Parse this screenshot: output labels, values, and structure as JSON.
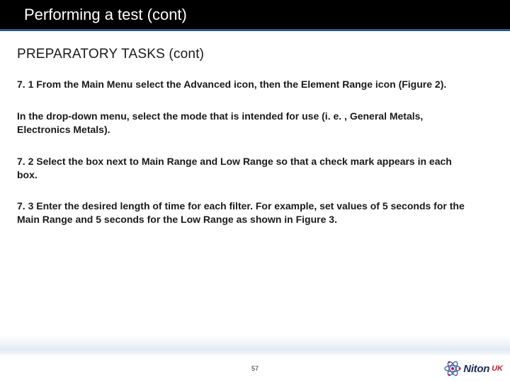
{
  "header": {
    "title": "Performing a test (cont)"
  },
  "content": {
    "section_heading": "PREPARATORY TASKS (cont)",
    "paragraphs": [
      "7. 1 From the Main Menu select the Advanced icon, then the Element Range icon (Figure 2).",
      "In the drop-down menu, select the mode that is intended for use (i. e. , General Metals, Electronics Metals).",
      "7. 2 Select the box next to Main Range and Low Range so that a check mark appears in each box.",
      "7. 3 Enter the desired length of time for each filter. For example, set values of 5 seconds for the Main Range and 5 seconds for the Low Range as shown in Figure 3."
    ]
  },
  "footer": {
    "page_number": "57",
    "logo": {
      "brand": "Niton",
      "suffix": "UK"
    }
  }
}
